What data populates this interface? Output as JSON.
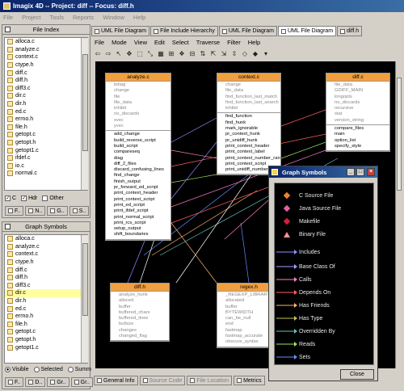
{
  "window": {
    "title": "Imagix 4D  --  Project: diff  --  Focus: diff.h"
  },
  "menu": [
    "File",
    "Project",
    "Tools",
    "Reports",
    "Window",
    "Help"
  ],
  "file_index": {
    "title": "File Index",
    "items": [
      "alloca.c",
      "analyze.c",
      "context.c",
      "ctype.h",
      "diff.c",
      "diff.h",
      "diff3.c",
      "dir.c",
      "dir.h",
      "ed.c",
      "errno.h",
      "file.h",
      "getopt.c",
      "getopt.h",
      "getopt1.c",
      "ifdef.c",
      "io.c",
      "normal.c"
    ],
    "filters": [
      {
        "label": "C",
        "checked": true
      },
      {
        "label": "Hdr",
        "checked": true
      },
      {
        "label": "Other",
        "checked": false
      }
    ],
    "tabs": [
      "F..",
      "N..",
      "G..",
      "S.."
    ]
  },
  "graph_symbols_panel": {
    "title": "Graph Symbols",
    "items": [
      "alloca.c",
      "analyze.c",
      "context.c",
      "ctype.h",
      "diff.c",
      "diff.h",
      "diff3.c",
      "dir.c",
      "dir.h",
      "ed.c",
      "errno.h",
      "file.h",
      "getopt.c",
      "getopt.h",
      "getopt1.c"
    ],
    "selected": "dir.c",
    "radios": [
      {
        "label": "Visible",
        "checked": true
      },
      {
        "label": "Selected",
        "checked": false
      },
      {
        "label": "Summ",
        "checked": false
      }
    ],
    "tabs": [
      "F..",
      "D..",
      "Gr..",
      "Gr.."
    ]
  },
  "doc_tabs": [
    "UML File Diagram",
    "File Include Hierarchy",
    "UML File Diagram",
    "UML File Diagram",
    "diff.h"
  ],
  "doc_menu": [
    "File",
    "Mode",
    "View",
    "Edit",
    "Select",
    "Traverse",
    "Filter",
    "Help"
  ],
  "diagram": {
    "nodes": [
      {
        "name": "analyze.c",
        "sections": [
          [
            "bdiag",
            "change",
            "file",
            "file_data",
            "inhibit",
            "no_discards",
            "xvec",
            "yvec"
          ],
          [
            "add_change",
            "build_reverse_script",
            "build_script",
            "compareseq",
            "diag",
            "diff_2_files",
            "discard_confusing_lines",
            "find_change",
            "finish_output",
            "pr_forward_ed_script",
            "print_context_header",
            "print_context_script",
            "print_ed_script",
            "print_ifdef_script",
            "print_normal_script",
            "print_rcs_script",
            "setup_output",
            "shift_boundaries"
          ]
        ]
      },
      {
        "name": "context.c",
        "sections": [
          [
            "change",
            "file_data",
            "find_function_last_match",
            "find_function_last_search",
            "inhibit"
          ],
          [
            "find_function",
            "find_hunk",
            "mark_ignorable",
            "pr_context_hunk",
            "pr_unidiff_hunk",
            "print_context_header",
            "print_context_label",
            "print_context_number_range",
            "print_context_script",
            "print_unidiff_number_range"
          ]
        ]
      },
      {
        "name": "diff.c",
        "sections": [
          [
            "file_data",
            "GDIFF_MAIN",
            "longopts",
            "no_discards",
            "recursive",
            "stat",
            "version_string"
          ],
          [
            "compare_files",
            "main",
            "option_list",
            "specify_style"
          ]
        ]
      },
      {
        "name": "diff.h",
        "sections": [
          [
            "analyze_hunk",
            "alloced",
            "buffer",
            "buffered_chars",
            "buffered_lines",
            "bufsize",
            "changes",
            "changed_flag"
          ]
        ]
      },
      {
        "name": "regex.h",
        "sections": [
          [
            "_REGEXP_LIBRARY",
            "allocated",
            "buffer",
            "BYTEWIDTH",
            "can_be_null",
            "end",
            "fastmap",
            "fastmap_accurate",
            "obscure_syntax"
          ]
        ]
      }
    ]
  },
  "graph_symbols_dialog": {
    "title": "Graph Symbols",
    "legend": [
      {
        "label": "C Source File",
        "color": "#f08030",
        "shape": "diamond"
      },
      {
        "label": "Java Source File",
        "color": "#e060a0",
        "shape": "diamond"
      },
      {
        "label": "Makefile",
        "color": "#d02040",
        "shape": "diamond"
      },
      {
        "label": "Binary File",
        "color": "#ff9090",
        "shape": "triangle"
      },
      {
        "label": "Includes",
        "color": "#9090ff",
        "shape": "arrow"
      },
      {
        "label": "Base Class Of",
        "color": "#a0a0ff",
        "shape": "arrow"
      },
      {
        "label": "Calls",
        "color": "#ff80c0",
        "shape": "arrow"
      },
      {
        "label": "Depends On",
        "color": "#ff6060",
        "shape": "arrow"
      },
      {
        "label": "Has Friends",
        "color": "#ffb070",
        "shape": "arrow"
      },
      {
        "label": "Has Type",
        "color": "#c0c060",
        "shape": "arrow"
      },
      {
        "label": "Overridden By",
        "color": "#60c0c0",
        "shape": "arrow"
      },
      {
        "label": "Reads",
        "color": "#a0e060",
        "shape": "arrow"
      },
      {
        "label": "Sets",
        "color": "#6090ff",
        "shape": "arrow"
      }
    ],
    "close_label": "Close"
  },
  "status_tabs": [
    "General Info",
    "Source Code",
    "File Location",
    "Metrics"
  ]
}
